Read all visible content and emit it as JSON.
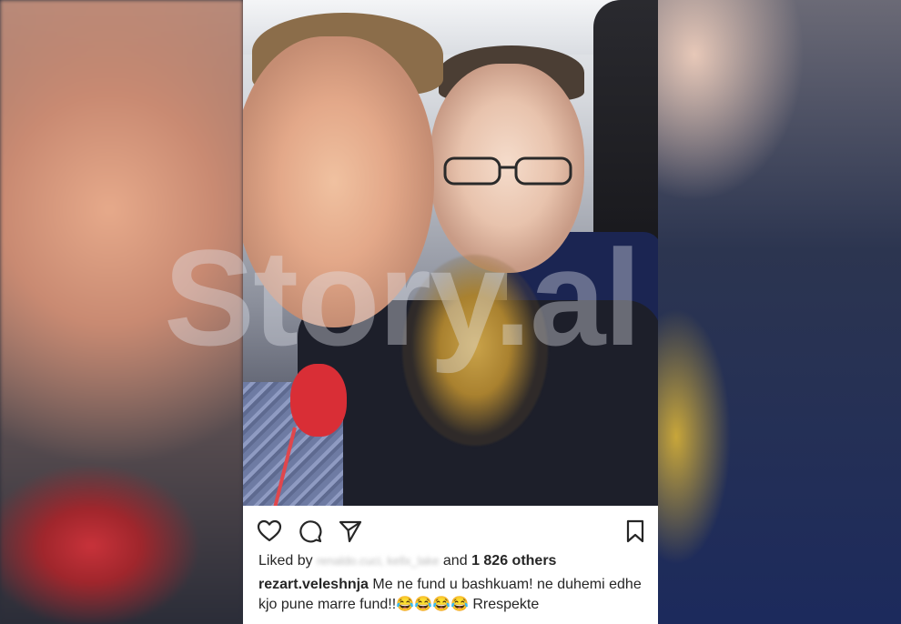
{
  "watermark": "Story.al",
  "post": {
    "liked_by_label": "Liked by",
    "liked_by_users": "renaldo.cuci, kellx_lake",
    "and_label": "and",
    "likes_count": "1 826 others",
    "username": "rezart.veleshnja",
    "caption_line1": "Me ne fund u bashkuam! ne duhemi edhe",
    "caption_line2": "kjo pune marre fund!!😂😂😂😂 Rrespekte"
  },
  "icons": {
    "like": "heart-icon",
    "comment": "comment-icon",
    "share": "send-icon",
    "save": "bookmark-icon"
  }
}
